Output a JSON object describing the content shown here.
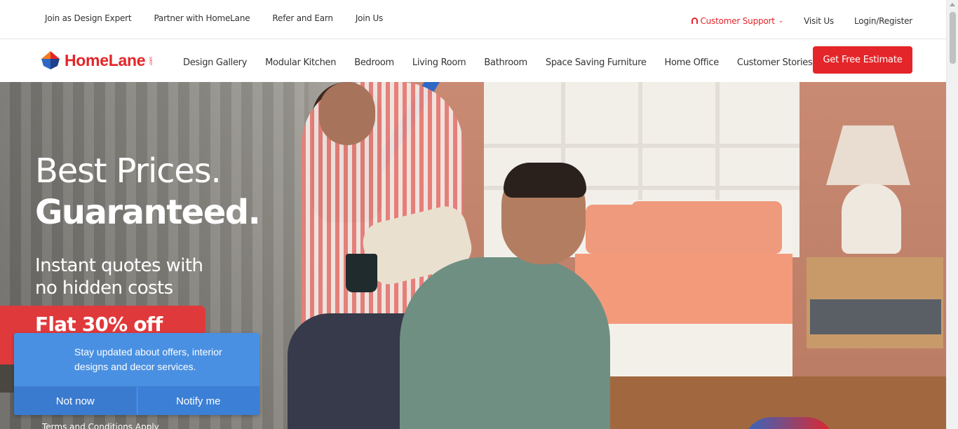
{
  "topbar": {
    "links": [
      "Join as Design Expert",
      "Partner with HomeLane",
      "Refer and Earn",
      "Join Us"
    ],
    "support_label": "Customer Support",
    "visit_label": "Visit Us",
    "login_label": "Login/Register"
  },
  "nav": {
    "brand": "HomeLane",
    "brand_tm": ".com",
    "items": [
      "Design Gallery",
      "Modular Kitchen",
      "Bedroom",
      "Living Room",
      "Bathroom",
      "Space Saving Furniture",
      "Home Office",
      "Customer Stories"
    ],
    "cta_label": "Get Free Estimate"
  },
  "hero": {
    "title_line1": "Best Prices.",
    "title_line2": "Guaranteed.",
    "subtitle": "Instant quotes with no hidden costs",
    "offer": "Flat 30% off",
    "terms": "Terms and Conditions Apply"
  },
  "notification": {
    "message": "Stay updated about offers, interior designs and decor services.",
    "decline_label": "Not now",
    "accept_label": "Notify me"
  },
  "colors": {
    "brand_red": "#e42529",
    "notify_blue": "#4a90e2",
    "stripe_blue": "#2f68c4"
  }
}
